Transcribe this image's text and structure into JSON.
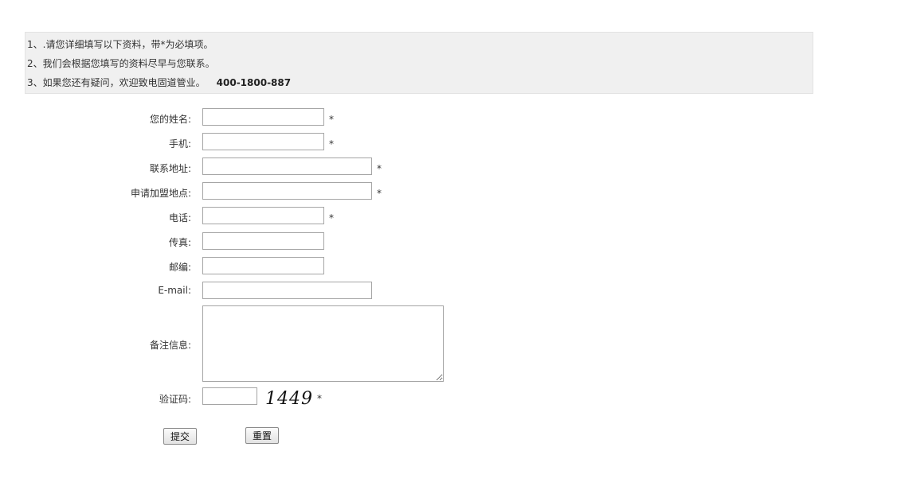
{
  "notice": {
    "line1": "1、.请您详细填写以下资料，带*为必填项。",
    "line2": "2、我们会根据您填写的资料尽早与您联系。",
    "line3": "3、如果您还有疑问，欢迎致电固道管业。",
    "phone": "400-1800-887"
  },
  "form": {
    "name_label": "您的姓名:",
    "mobile_label": "手机:",
    "address_label": "联系地址:",
    "franchise_label": "申请加盟地点:",
    "phone_label": "电话:",
    "fax_label": "传真:",
    "zip_label": "邮编:",
    "email_label": "E-mail:",
    "remarks_label": "备注信息:",
    "captcha_label": "验证码:",
    "required_mark": "*",
    "captcha_text": "1449"
  },
  "buttons": {
    "submit": "提交",
    "reset": "重置"
  }
}
